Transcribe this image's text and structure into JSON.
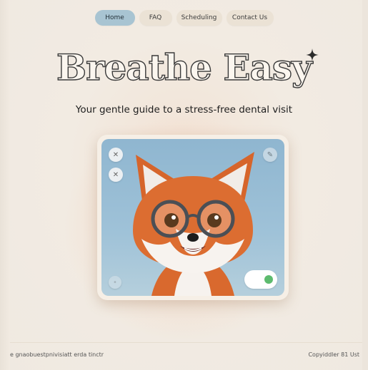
{
  "nav": {
    "items": [
      {
        "label": "Home",
        "active": true
      },
      {
        "label": "FAQ",
        "active": false
      },
      {
        "label": "Scheduling",
        "active": false
      },
      {
        "label": "Contact Us",
        "active": false
      }
    ]
  },
  "hero": {
    "title": "Breathe Easy",
    "subtitle": "Your gentle guide to a stress-free dental visit"
  },
  "card": {
    "image": "fox-with-glasses",
    "toggle_on": true
  },
  "footer": {
    "left_text": "e gnaobuestpnivisiatt erda tinctr",
    "right_text": "Copyiddler 81 Ust"
  },
  "colors": {
    "background": "#f2ebe2",
    "active_pill": "#a8c4d2",
    "pill": "#ebe2d5",
    "toggle_indicator": "#5dbb6e",
    "sky": "#9fc2d8"
  }
}
